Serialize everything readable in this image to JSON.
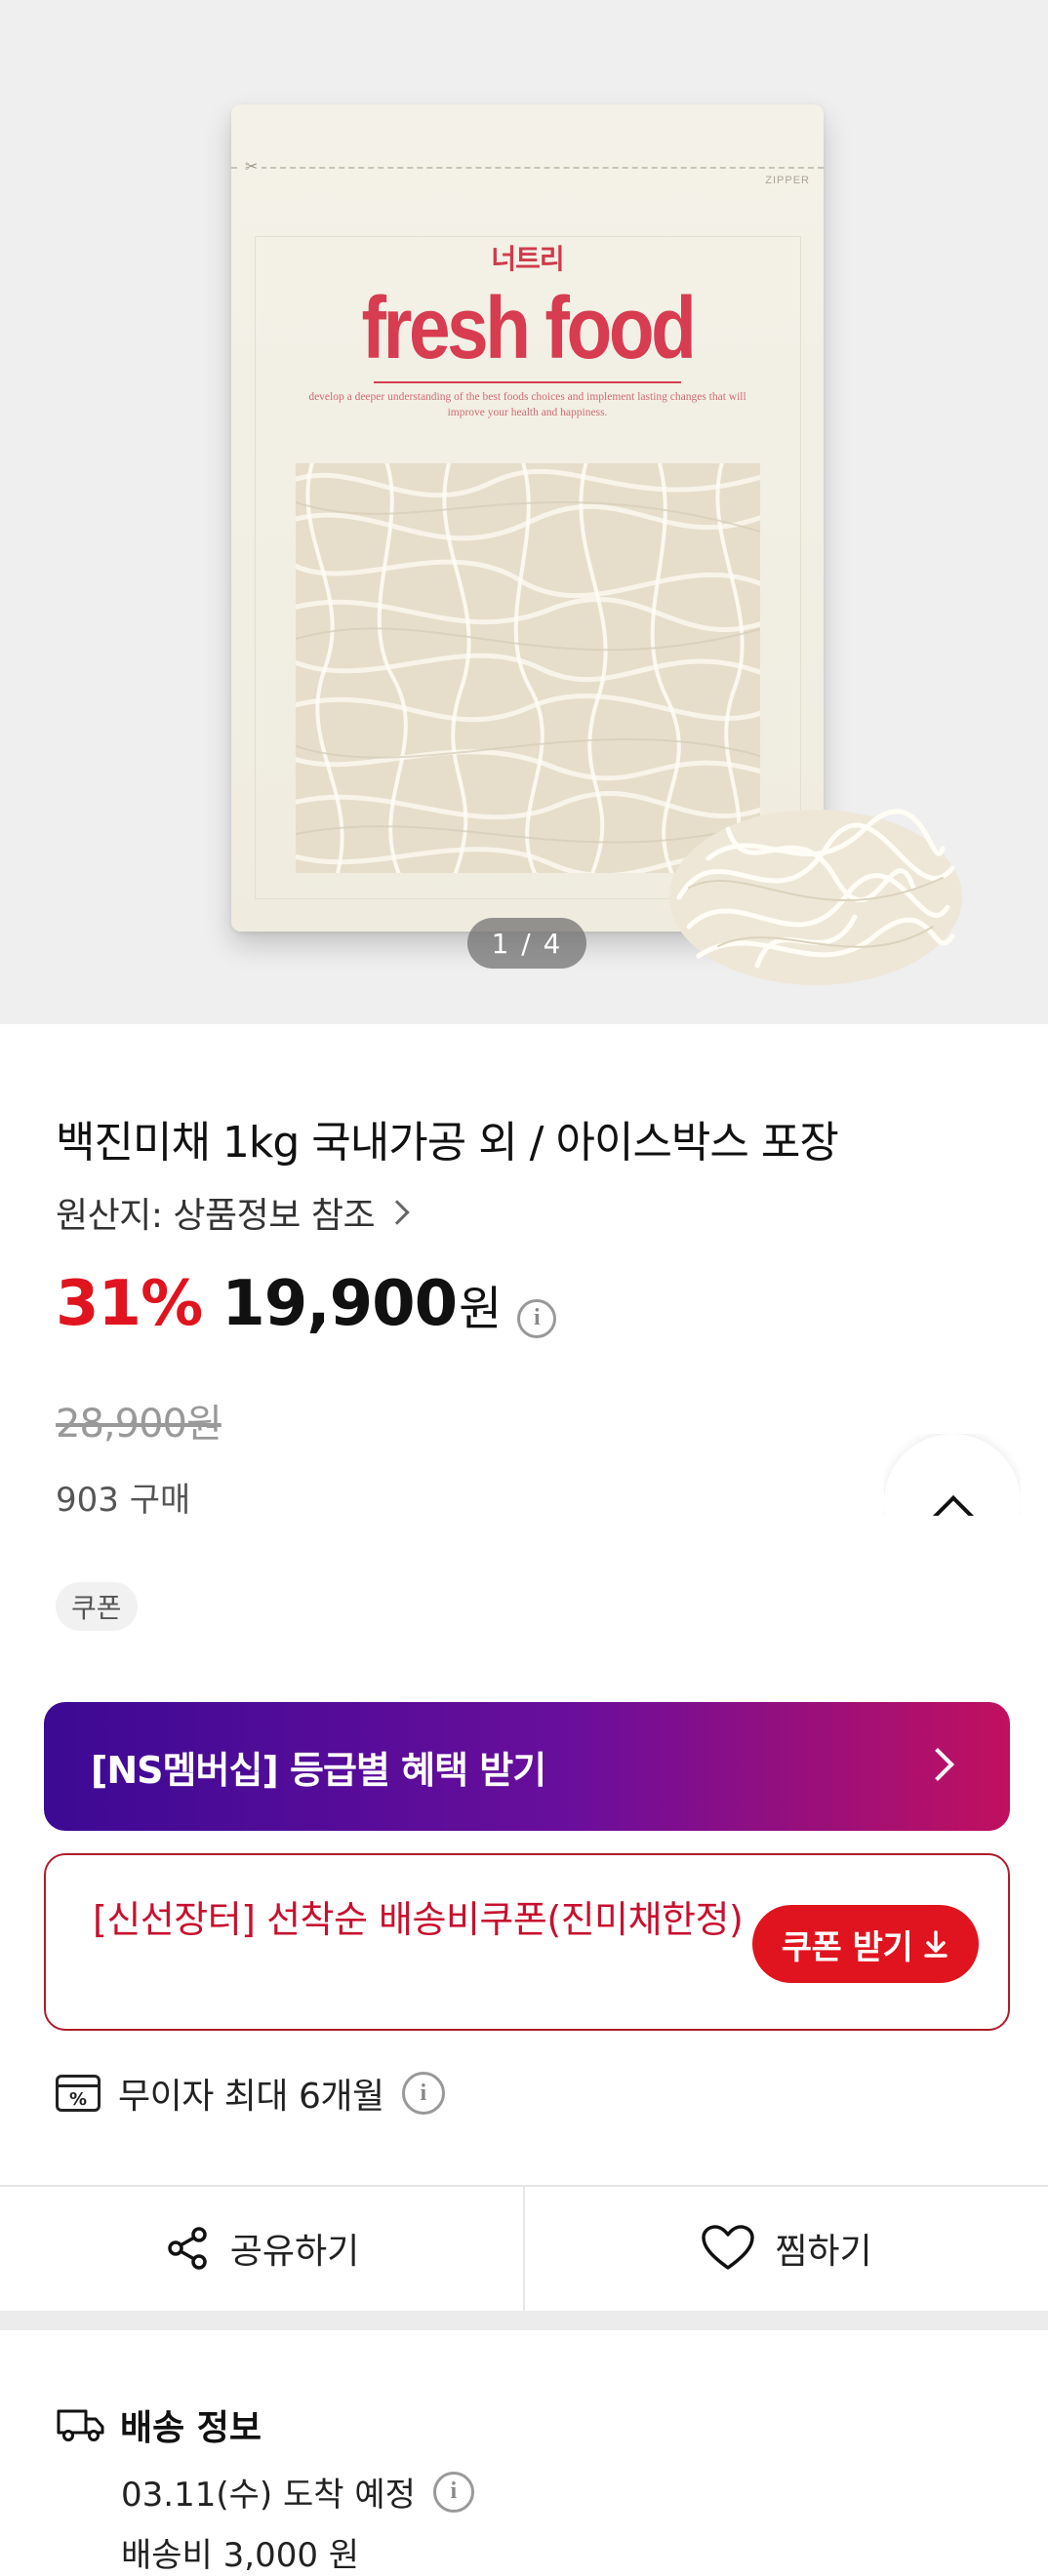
{
  "hero": {
    "package": {
      "brand_logo": "너트리",
      "headline": "fresh food",
      "tagline": "develop a deeper understanding of the best foods choices and implement lasting changes that will improve your health and happiness.",
      "zipper_mark": "ZIPPER"
    },
    "pager": "1 / 4"
  },
  "product": {
    "title": "백진미채 1kg 국내가공 외 / 아이스박스 포장",
    "origin": "원산지: 상품정보 참조",
    "discount": "31%",
    "price": "19,900",
    "currency": "원",
    "original_price": "28,900원",
    "purchases": "903 구매",
    "coupon_chip": "쿠폰"
  },
  "ns_banner": {
    "label": "[NS멤버십] 등급별 혜택 받기"
  },
  "ship_coupon": {
    "text": "[신선장터] 선착순 배송비쿠폰(진미채한정)",
    "button": "쿠폰 받기"
  },
  "installment": {
    "label": "무이자 최대 6개월"
  },
  "actions": {
    "share": "공유하기",
    "wish": "찜하기"
  },
  "delivery": {
    "heading": "배송 정보",
    "date": "03.11(수) 도착 예정",
    "fee": "배송비 3,000 원"
  },
  "colors": {
    "discount_red": "#e0141e",
    "brand_pink": "#d73c50",
    "banner_start": "#3c0a94",
    "banner_end": "#c1105f"
  },
  "icons": [
    "info-icon",
    "chevron-right-icon",
    "chevron-up-icon",
    "download-icon",
    "card-percent-icon",
    "share-icon",
    "heart-icon",
    "truck-icon"
  ]
}
